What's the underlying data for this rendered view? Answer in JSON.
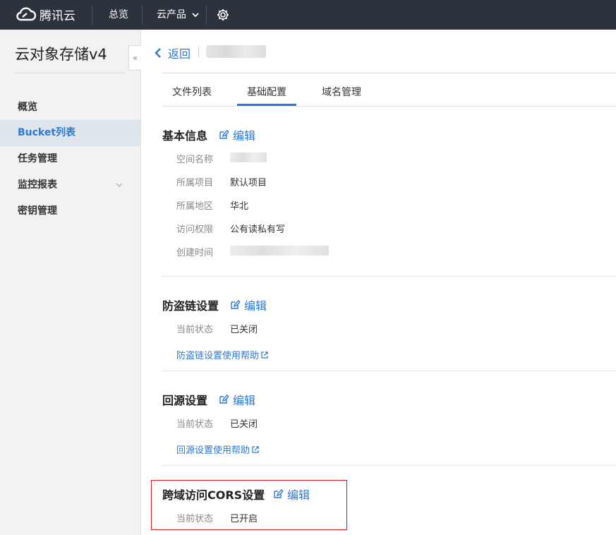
{
  "topbar": {
    "brand": "腾讯云",
    "nav_overview": "总览",
    "nav_products": "云产品"
  },
  "sidebar": {
    "title": "云对象存储v4",
    "collapse_glyph": "«",
    "items": [
      {
        "label": "概览"
      },
      {
        "label": "Bucket列表"
      },
      {
        "label": "任务管理"
      },
      {
        "label": "监控报表"
      },
      {
        "label": "密钥管理"
      }
    ]
  },
  "header": {
    "back_label": "返回"
  },
  "tabs": [
    {
      "label": "文件列表"
    },
    {
      "label": "基础配置"
    },
    {
      "label": "域名管理"
    }
  ],
  "edit_label": "编辑",
  "basic_info": {
    "title": "基本信息",
    "rows": [
      {
        "label": "空间名称",
        "value": ""
      },
      {
        "label": "所属项目",
        "value": "默认项目"
      },
      {
        "label": "所属地区",
        "value": "华北"
      },
      {
        "label": "访问权限",
        "value": "公有读私有写"
      },
      {
        "label": "创建时间",
        "value": ""
      }
    ]
  },
  "hotlink": {
    "title": "防盗链设置",
    "status_label": "当前状态",
    "status_value": "已关闭",
    "help": "防盗链设置使用帮助"
  },
  "origin": {
    "title": "回源设置",
    "status_label": "当前状态",
    "status_value": "已关闭",
    "help": "回源设置使用帮助"
  },
  "cors": {
    "title": "跨域访问CORS设置",
    "status_label": "当前状态",
    "status_value": "已开启"
  },
  "colors": {
    "topbar_bg": "#2c333d",
    "accent": "#2b79d3",
    "highlight_border": "#e0161c"
  }
}
